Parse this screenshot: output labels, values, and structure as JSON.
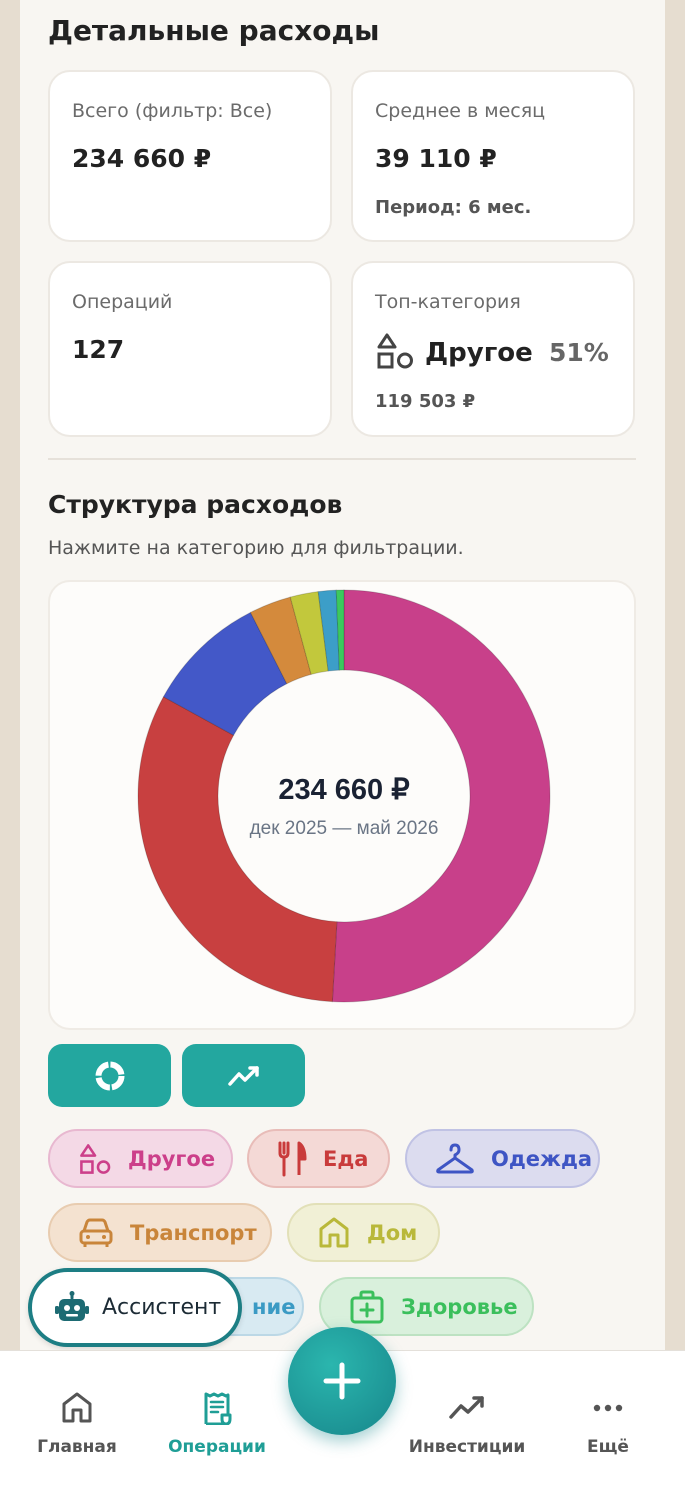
{
  "header": {
    "title": "Детальные расходы"
  },
  "stats": {
    "total": {
      "label": "Всего (фильтр: Все)",
      "value": "234 660 ₽"
    },
    "avg": {
      "label": "Среднее в месяц",
      "value": "39 110 ₽",
      "period": "Период: 6 мес."
    },
    "ops": {
      "label": "Операций",
      "value": "127"
    },
    "top": {
      "label": "Топ-категория",
      "name": "Другое",
      "pct": "51%",
      "amount": "119 503 ₽"
    }
  },
  "structure": {
    "title": "Структура расходов",
    "hint": "Нажмите на категорию для фильтрации."
  },
  "chart_data": {
    "type": "pie",
    "center_total": "234 660 ₽",
    "center_period": "дек 2025 — май 2026",
    "categories": [
      "Другое",
      "Еда",
      "Одежда",
      "Транспорт",
      "Дом",
      "Образование",
      "Здоровье"
    ],
    "values": [
      50.9,
      32.1,
      9.5,
      3.3,
      2.2,
      1.4,
      0.6
    ],
    "colors": [
      "#c8408a",
      "#c84040",
      "#4358c8",
      "#d48a3c",
      "#c2c83c",
      "#3c9ec8",
      "#3cc85e"
    ]
  },
  "chips": [
    {
      "label": "Другое",
      "icon": "shapes-icon",
      "color": "#cc3f8a",
      "bg": "#f4d9e6",
      "border": "#e8b8d0"
    },
    {
      "label": "Еда",
      "icon": "cutlery-icon",
      "color": "#c93b3b",
      "bg": "#f4d9d6",
      "border": "#e8bcb8"
    },
    {
      "label": "Одежда",
      "icon": "hanger-icon",
      "color": "#3e55c4",
      "bg": "#dcdcef",
      "border": "#c0c2e4"
    },
    {
      "label": "Транспорт",
      "icon": "car-icon",
      "color": "#c9853a",
      "bg": "#f4e2d0",
      "border": "#e8ccb0"
    },
    {
      "label": "Дом",
      "icon": "home-icon",
      "color": "#b9b83a",
      "bg": "#f1f0d6",
      "border": "#e2e0b8"
    },
    {
      "label": "Образование",
      "partial": "ние",
      "icon": "book-icon",
      "color": "#3a9ac4",
      "bg": "#d8eaf2",
      "border": "#bcd8e6"
    },
    {
      "label": "Здоровье",
      "icon": "medkit-icon",
      "color": "#3bbf5c",
      "bg": "#d9f0dc",
      "border": "#bde2c2"
    }
  ],
  "assistant": {
    "label": "Ассистент"
  },
  "nav": {
    "home": "Главная",
    "ops": "Операции",
    "invest": "Инвестиции",
    "more": "Ещё"
  }
}
